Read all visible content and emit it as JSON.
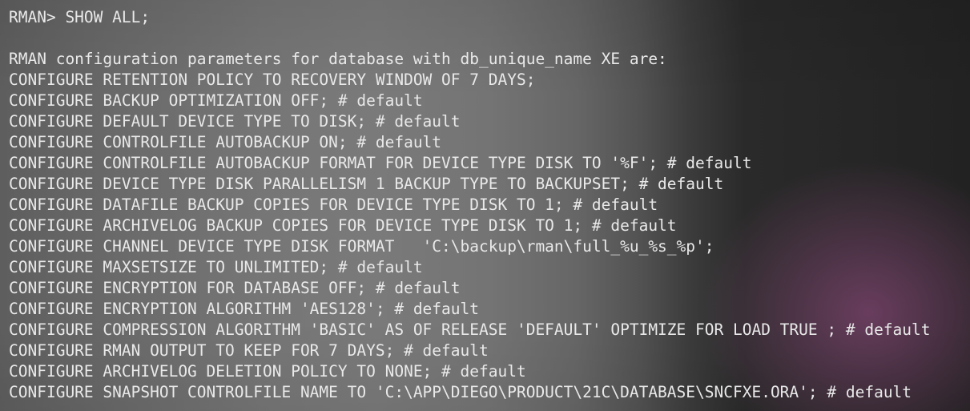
{
  "terminal": {
    "prompt_line": "RMAN> SHOW ALL;",
    "blank_line": "",
    "header_line": "RMAN configuration parameters for database with db_unique_name XE are:",
    "config_lines": [
      "CONFIGURE RETENTION POLICY TO RECOVERY WINDOW OF 7 DAYS;",
      "CONFIGURE BACKUP OPTIMIZATION OFF; # default",
      "CONFIGURE DEFAULT DEVICE TYPE TO DISK; # default",
      "CONFIGURE CONTROLFILE AUTOBACKUP ON; # default",
      "CONFIGURE CONTROLFILE AUTOBACKUP FORMAT FOR DEVICE TYPE DISK TO '%F'; # default",
      "CONFIGURE DEVICE TYPE DISK PARALLELISM 1 BACKUP TYPE TO BACKUPSET; # default",
      "CONFIGURE DATAFILE BACKUP COPIES FOR DEVICE TYPE DISK TO 1; # default",
      "CONFIGURE ARCHIVELOG BACKUP COPIES FOR DEVICE TYPE DISK TO 1; # default",
      "CONFIGURE CHANNEL DEVICE TYPE DISK FORMAT   'C:\\backup\\rman\\full_%u_%s_%p';",
      "CONFIGURE MAXSETSIZE TO UNLIMITED; # default",
      "CONFIGURE ENCRYPTION FOR DATABASE OFF; # default",
      "CONFIGURE ENCRYPTION ALGORITHM 'AES128'; # default",
      "CONFIGURE COMPRESSION ALGORITHM 'BASIC' AS OF RELEASE 'DEFAULT' OPTIMIZE FOR LOAD TRUE ; # default",
      "CONFIGURE RMAN OUTPUT TO KEEP FOR 7 DAYS; # default",
      "CONFIGURE ARCHIVELOG DELETION POLICY TO NONE; # default",
      "CONFIGURE SNAPSHOT CONTROLFILE NAME TO 'C:\\APP\\DIEGO\\PRODUCT\\21C\\DATABASE\\SNCFXE.ORA'; # default"
    ]
  },
  "colors": {
    "text": "#e9e9e9",
    "background_dark": "#222222",
    "background_light": "#7a7a7a",
    "glow_accent": "#a0508c"
  }
}
